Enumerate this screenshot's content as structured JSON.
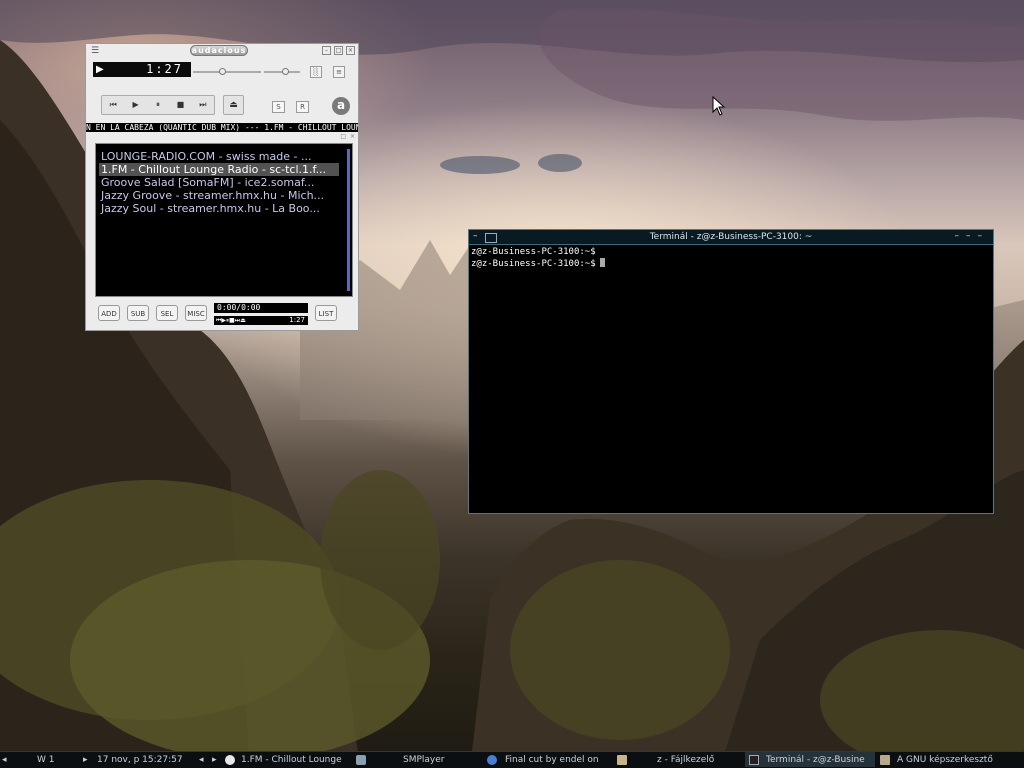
{
  "audacious": {
    "logo_text": "audacious",
    "menu_icon": "hamburger-icon",
    "time": "1:27",
    "play_indicator": "▶",
    "transport": [
      "⏮",
      "▶",
      "⏸",
      "■",
      "⏭"
    ],
    "eject": "⏏",
    "shuffle": "S",
    "repeat": "R",
    "marquee": "N EN LA CABEZA (QUANTIC DUB MIX) --- 1.FM - CHILLOUT LOUNGE",
    "playlist": [
      {
        "title": "LOUNGE-RADIO.COM - swiss made - ..."
      },
      {
        "title": "1.FM - Chillout Lounge Radio - sc-tcl.1.f..."
      },
      {
        "title": "Groove Salad [SomaFM] - ice2.somaf..."
      },
      {
        "title": "Jazzy Groove - streamer.hmx.hu - Mich..."
      },
      {
        "title": "Jazzy Soul - streamer.hmx.hu - La Boo..."
      }
    ],
    "selected_index": 1,
    "buttons": {
      "add": "ADD",
      "sub": "SUB",
      "sel": "SEL",
      "misc": "MISC",
      "list": "LIST"
    },
    "playlist_time": "0:00/0:00",
    "mini_time": "1:27"
  },
  "terminal": {
    "title": "Terminál - z@z-Business-PC-3100: ~",
    "lines": [
      "z@z-Business-PC-3100:~$",
      "z@z-Business-PC-3100:~$"
    ]
  },
  "taskbar": {
    "workspace": "W 1",
    "datetime": "17 nov, p 15:27:57",
    "items": [
      {
        "label": "1.FM - Chillout Lounge",
        "icon": "audacious-icon"
      },
      {
        "label": "SMPlayer",
        "icon": "smplayer-icon"
      },
      {
        "label": "Final cut by endel on",
        "icon": "browser-icon"
      },
      {
        "label": "z - Fájlkezelő",
        "icon": "folder-icon"
      },
      {
        "label": "Terminál - z@z-Busine",
        "icon": "terminal-icon",
        "active": true
      },
      {
        "label": "A GNU képszerkesztő",
        "icon": "gimp-icon"
      }
    ]
  }
}
